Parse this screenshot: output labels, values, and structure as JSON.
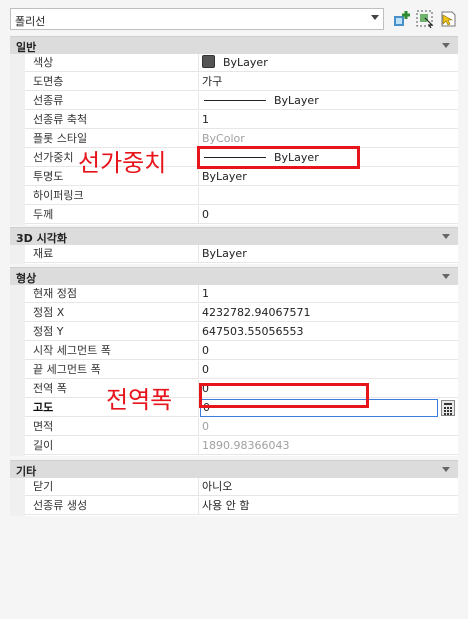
{
  "toolbar": {
    "object_type": "폴리선",
    "icons": [
      "toggle-pickadd-icon",
      "select-objects-icon",
      "quick-select-icon"
    ]
  },
  "sections": {
    "general": {
      "title": "일반",
      "rows": [
        {
          "key": "색상",
          "value": "ByLayer"
        },
        {
          "key": "도면층",
          "value": "가구"
        },
        {
          "key": "선종류",
          "value": "ByLayer"
        },
        {
          "key": "선종류 축척",
          "value": "1"
        },
        {
          "key": "플롯 스타일",
          "value": "ByColor"
        },
        {
          "key": "선가중치",
          "value": "ByLayer"
        },
        {
          "key": "투명도",
          "value": "ByLayer"
        },
        {
          "key": "하이퍼링크",
          "value": ""
        },
        {
          "key": "두께",
          "value": "0"
        }
      ]
    },
    "viz3d": {
      "title": "3D 시각화",
      "rows": [
        {
          "key": "재료",
          "value": "ByLayer"
        }
      ]
    },
    "geometry": {
      "title": "형상",
      "rows": [
        {
          "key": "현재 정점",
          "value": "1"
        },
        {
          "key": "정점 X",
          "value": "4232782.94067571"
        },
        {
          "key": "정점 Y",
          "value": "647503.55056553"
        },
        {
          "key": "시작 세그먼트 폭",
          "value": "0"
        },
        {
          "key": "끝 세그먼트 폭",
          "value": "0"
        },
        {
          "key": "전역 폭",
          "value": "0"
        },
        {
          "key": "고도",
          "value": "0"
        },
        {
          "key": "면적",
          "value": "0"
        },
        {
          "key": "길이",
          "value": "1890.98366043"
        }
      ]
    },
    "misc": {
      "title": "기타",
      "rows": [
        {
          "key": "닫기",
          "value": "아니오"
        },
        {
          "key": "선종류 생성",
          "value": "사용 안 함"
        }
      ]
    }
  },
  "annotations": {
    "lineweight": "선가중치",
    "global_width": "전역폭",
    "color": "#e8141c"
  }
}
